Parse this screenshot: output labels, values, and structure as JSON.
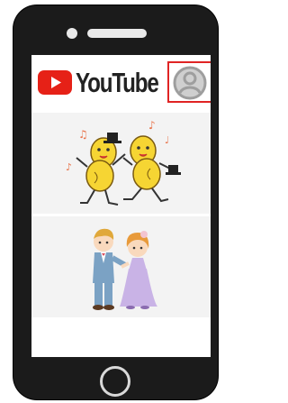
{
  "app": {
    "brand_label": "YouTube"
  },
  "header": {
    "account_icon": "account-icon",
    "highlight_color": "#e02424"
  },
  "feed": {
    "items": [
      {
        "thumbnail": "dancing-peanuts-illustration"
      },
      {
        "thumbnail": "wedding-couple-illustration"
      }
    ]
  },
  "device": {
    "home_button": "home-button"
  },
  "colors": {
    "brand_red": "#e62117",
    "phone_body": "#1b1b1b"
  }
}
